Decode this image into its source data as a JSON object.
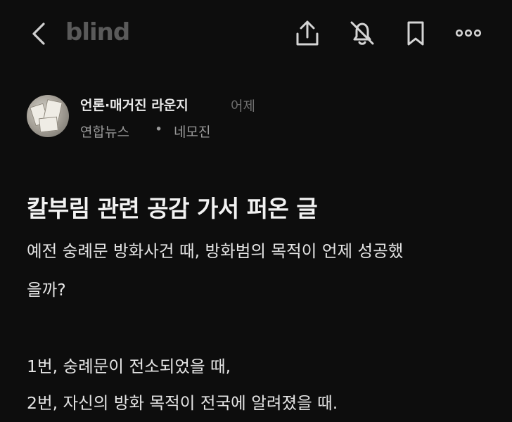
{
  "header": {
    "logo": "blind",
    "icons": [
      "back-icon",
      "share-icon",
      "notifications-off-icon",
      "bookmark-icon",
      "more-icon"
    ]
  },
  "post": {
    "channel": "언론·매거진 라운지",
    "time": "어제",
    "company": "연합뉴스",
    "separator": "•",
    "nickname": "네모진",
    "title": "칼부림 관련 공감 가서 퍼온 글",
    "body": {
      "line1": "예전 숭례문 방화사건 때, 방화범의 목적이 언제 성공했",
      "line2": "을까?",
      "line3": "1번, 숭례문이 전소되었을 때,",
      "line4": "2번, 자신의 방화 목적이 전국에 알려졌을 때."
    }
  },
  "colors": {
    "background": "#0d0d0d",
    "text": "#e6e6e6",
    "muted": "#9a9a9a",
    "logo": "#5a5a5a"
  }
}
